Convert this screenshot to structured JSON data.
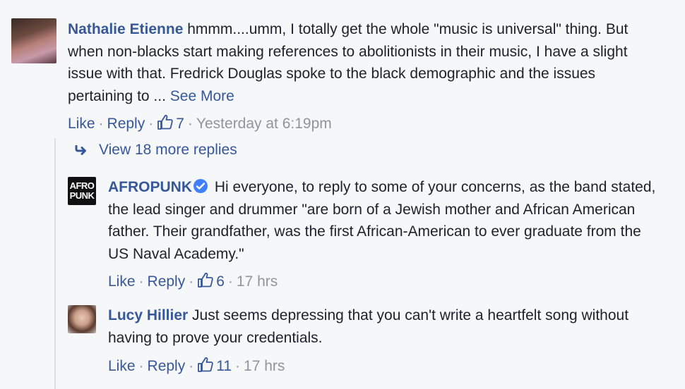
{
  "comments": [
    {
      "author": "Nathalie Etienne",
      "text": "hmmm....umm, I totally get the whole \"music is universal\" thing. But when non-blacks start making references to abolitionists in their music, I have a slight issue with that. Fredrick Douglas spoke to the black demographic and the issues pertaining to ... ",
      "see_more": "See More",
      "like": "Like",
      "reply": "Reply",
      "likes": "7",
      "time": "Yesterday at 6:19pm"
    }
  ],
  "view_more": "View 18 more replies",
  "replies": [
    {
      "author": "AFROPUNK",
      "avatar_text": [
        "AFRO",
        "PUNK"
      ],
      "verified": true,
      "text": "Hi everyone, to reply to some of your concerns, as the band stated, the lead singer and drummer \"are born of a Jewish mother and African American father. Their grandfather, was the first African-American to ever graduate from the US Naval Academy.\"",
      "like": "Like",
      "reply": "Reply",
      "likes": "6",
      "time": "17 hrs"
    },
    {
      "author": "Lucy Hillier",
      "text": "Just seems depressing that you can't write a heartfelt song without having to prove your credentials.",
      "like": "Like",
      "reply": "Reply",
      "likes": "11",
      "time": "17 hrs"
    }
  ],
  "colors": {
    "link": "#365899",
    "meta": "#90949c",
    "text": "#1d2129",
    "background": "#f6f7f9",
    "verified": "#4080ff"
  }
}
